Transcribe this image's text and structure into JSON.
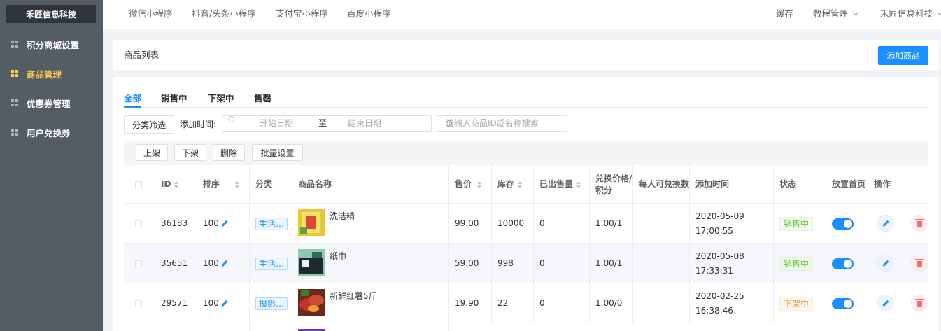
{
  "brand": "禾匠信息科技",
  "sidebar": {
    "items": [
      {
        "label": "积分商城设置",
        "active": false
      },
      {
        "label": "商品管理",
        "active": true
      },
      {
        "label": "优惠券管理",
        "active": false
      },
      {
        "label": "用户兑换券",
        "active": false
      }
    ]
  },
  "topbar": {
    "tabs": [
      "微信小程序",
      "抖音/头条小程序",
      "支付宝小程序",
      "百度小程序"
    ],
    "cache": "缓存",
    "tutorial": "教程管理",
    "account": "禾匠信息科技"
  },
  "page": {
    "title": "商品列表",
    "add_button": "添加商品"
  },
  "status_tabs": [
    "全部",
    "销售中",
    "下架中",
    "售罄"
  ],
  "filters": {
    "category_button": "分类筛选",
    "time_label": "添加时间:",
    "start_placeholder": "开始日期",
    "range_separator": "至",
    "end_placeholder": "结束日期",
    "search_placeholder": "请输入商品ID或名称搜索"
  },
  "batch": {
    "on_shelf": "上架",
    "off_shelf": "下架",
    "delete": "删除",
    "batch_settings": "批量设置"
  },
  "table": {
    "columns": {
      "id": "ID",
      "sort": "排序",
      "category": "分类",
      "name": "商品名称",
      "price": "售价",
      "stock": "库存",
      "sold": "已出售量",
      "exchange": "兑换价格/积分",
      "per_user": "每人可兑换数",
      "added": "添加时间",
      "status": "状态",
      "homepage": "放置首页",
      "ops": "操作"
    },
    "rows": [
      {
        "id": "36183",
        "sort": "100",
        "category": "生活…",
        "name": "洗洁精",
        "price": "99.00",
        "stock": "10000",
        "sold": "0",
        "exchange": "1.00/1",
        "added": "2020-05-09 17:00:55",
        "status": "销售中",
        "status_color": "#67c23a"
      },
      {
        "id": "35651",
        "sort": "100",
        "category": "生活…",
        "name": "纸巾",
        "price": "59.00",
        "stock": "998",
        "sold": "0",
        "exchange": "1.00/1",
        "added": "2020-05-08 17:33:31",
        "status": "销售中",
        "status_color": "#67c23a"
      },
      {
        "id": "29571",
        "sort": "100",
        "category": "摄影…",
        "name": "新鲜红薯5斤",
        "price": "19.90",
        "stock": "22",
        "sold": "0",
        "exchange": "1.00/0",
        "added": "2020-02-25 16:38:46",
        "status": "下架中",
        "status_color": "#e6a23c"
      }
    ]
  },
  "colors": {
    "primary": "#1890ff",
    "sidebar_bg": "#545c64",
    "sidebar_active": "#ffd04b"
  }
}
